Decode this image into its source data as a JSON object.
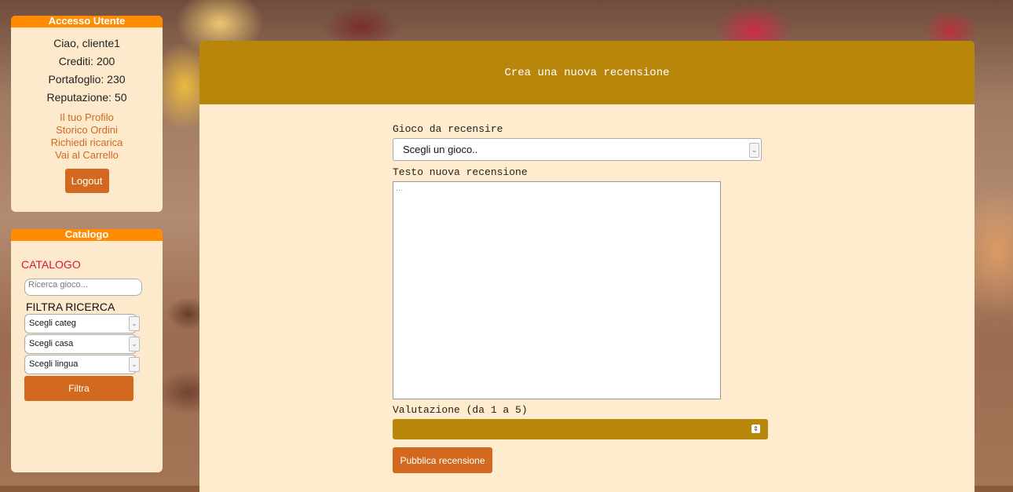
{
  "user_panel": {
    "title": "Accesso Utente",
    "greeting": "Ciao, cliente1",
    "credits": "Crediti: 200",
    "wallet": "Portafoglio: 230",
    "reputation": "Reputazione: 50",
    "links": [
      "Il tuo Profilo",
      "Storico Ordini",
      "Richiedi ricarica",
      "Vai al Carrello"
    ],
    "logout_label": "Logout"
  },
  "catalog_panel": {
    "title": "Catalogo",
    "heading": "CATALOGO",
    "search_placeholder": "Ricerca gioco...",
    "filter_label": "FILTRA RICERCA",
    "selects": [
      "Scegli categ",
      "Scegli casa",
      "Scegli lingua"
    ],
    "filter_button": "Filtra"
  },
  "review_form": {
    "title": "Crea una nuova recensione",
    "game_label": "Gioco da recensire",
    "game_selected": "Scegli un gioco..",
    "text_label": "Testo nuova recensione",
    "text_placeholder": "...",
    "rating_label": "Valutazione (da 1 a 5)",
    "rating_value": "",
    "submit_label": "Pubblica recensione"
  },
  "colors": {
    "accent_orange": "#ff8c00",
    "button": "#d2691e",
    "header_gold": "#b8860b",
    "panel_bg": "#fde9cc",
    "catalog_heading": "#dc143c"
  }
}
